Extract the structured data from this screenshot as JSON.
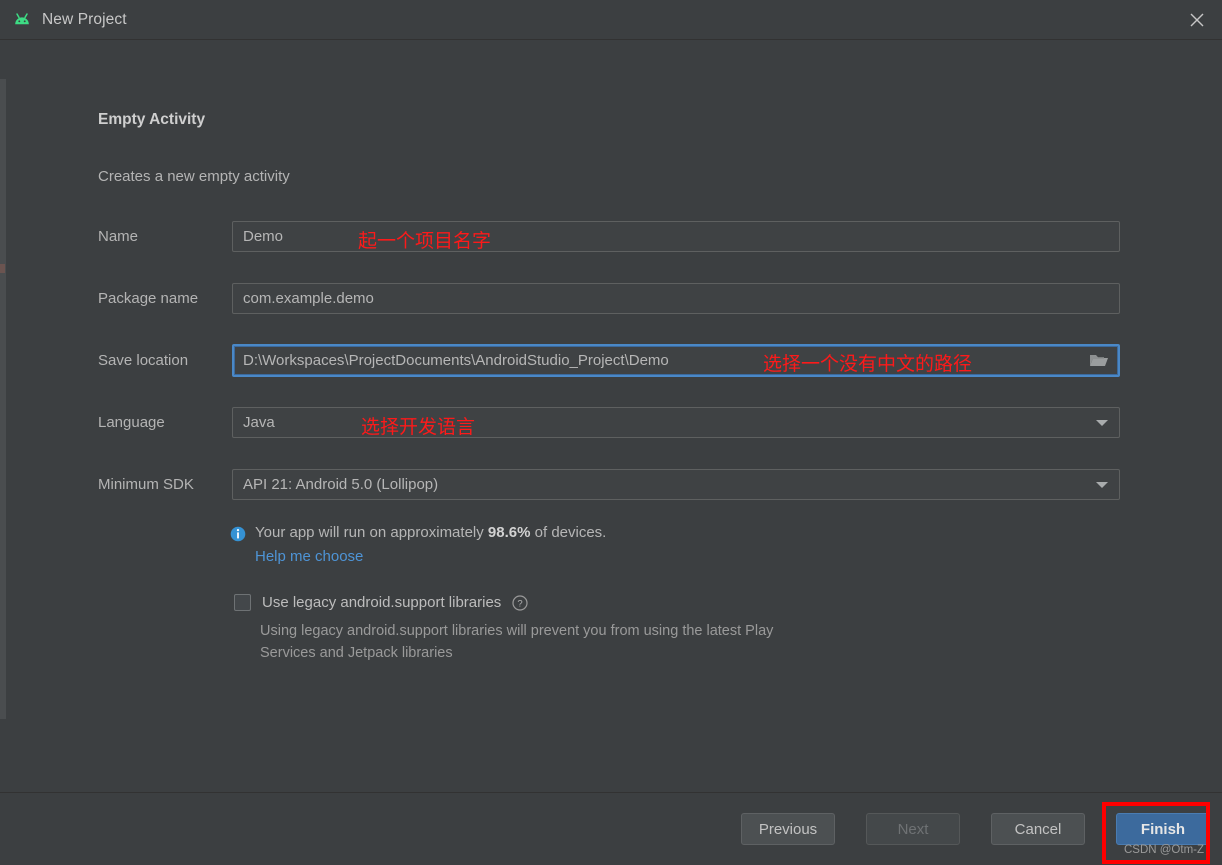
{
  "window": {
    "title": "New Project",
    "app_icon": "android-robot-icon",
    "close_icon": "close-icon",
    "accent_blue": "#4a88c7",
    "bg": "#3c3f41",
    "annotation_red": "#fc1a1a"
  },
  "template": {
    "heading": "Empty Activity",
    "subheading": "Creates a new empty activity"
  },
  "form": {
    "name": {
      "label": "Name",
      "value": "Demo",
      "annotation": "起一个项目名字"
    },
    "package_name": {
      "label": "Package name",
      "value": "com.example.demo"
    },
    "save_location": {
      "label": "Save location",
      "value": "D:\\Workspaces\\ProjectDocuments\\AndroidStudio_Project\\Demo",
      "annotation": "选择一个没有中文的路径",
      "browse_icon": "folder-icon"
    },
    "language": {
      "label": "Language",
      "value": "Java",
      "annotation": "选择开发语言",
      "dropdown_icon": "chevron-down-icon"
    },
    "minimum_sdk": {
      "label": "Minimum SDK",
      "value": "API 21: Android 5.0 (Lollipop)",
      "dropdown_icon": "chevron-down-icon"
    }
  },
  "info": {
    "icon": "info-icon",
    "text_before": "Your app will run on approximately ",
    "percent": "98.6%",
    "text_after": " of devices.",
    "link": "Help me choose"
  },
  "legacy": {
    "checkbox_label": "Use legacy android.support libraries",
    "checked": false,
    "help_icon": "question-mark-icon",
    "description": "Using legacy android.support libraries will prevent you from using the latest Play Services and Jetpack libraries"
  },
  "footer": {
    "previous": "Previous",
    "next": "Next",
    "next_disabled": true,
    "cancel": "Cancel",
    "finish": "Finish"
  },
  "watermark": "CSDN @Otm-Z"
}
